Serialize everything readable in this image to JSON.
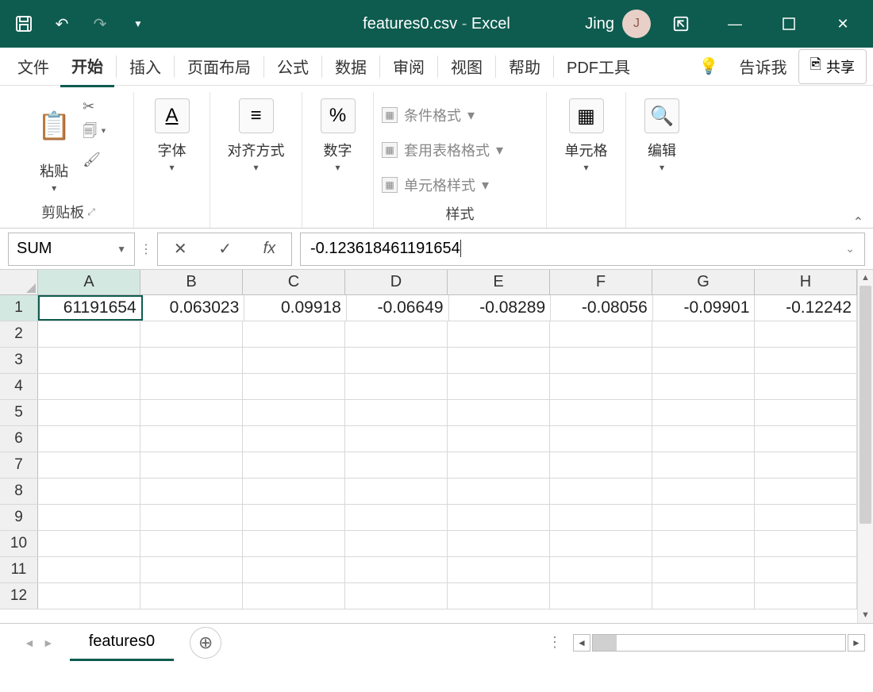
{
  "titlebar": {
    "filename": "features0.csv",
    "app": "Excel",
    "user": "Jing",
    "avatar": "J"
  },
  "ribbon_tabs": [
    "文件",
    "开始",
    "插入",
    "页面布局",
    "公式",
    "数据",
    "审阅",
    "视图",
    "帮助",
    "PDF工具"
  ],
  "ribbon_active": "开始",
  "tell_me": "告诉我",
  "share": "共享",
  "ribbon": {
    "clipboard": {
      "paste": "粘贴",
      "label": "剪贴板"
    },
    "font": "字体",
    "align": "对齐方式",
    "number": "数字",
    "styles": {
      "conditional": "条件格式",
      "table_fmt": "套用表格格式",
      "cell_styles": "单元格样式",
      "label": "样式"
    },
    "cells": "单元格",
    "edit": "编辑"
  },
  "formula_bar": {
    "name_box": "SUM",
    "formula": "-0.123618461191654"
  },
  "columns": [
    "A",
    "B",
    "C",
    "D",
    "E",
    "F",
    "G",
    "H"
  ],
  "row_headers": [
    "1",
    "2",
    "3",
    "4",
    "5",
    "6",
    "7",
    "8",
    "9",
    "10",
    "11",
    "12"
  ],
  "data": {
    "r1": [
      "61191654",
      "0.063023",
      "0.09918",
      "-0.06649",
      "-0.08289",
      "-0.08056",
      "-0.09901",
      "-0.12242"
    ]
  },
  "active_cell": "A1",
  "sheet": {
    "name": "features0"
  }
}
